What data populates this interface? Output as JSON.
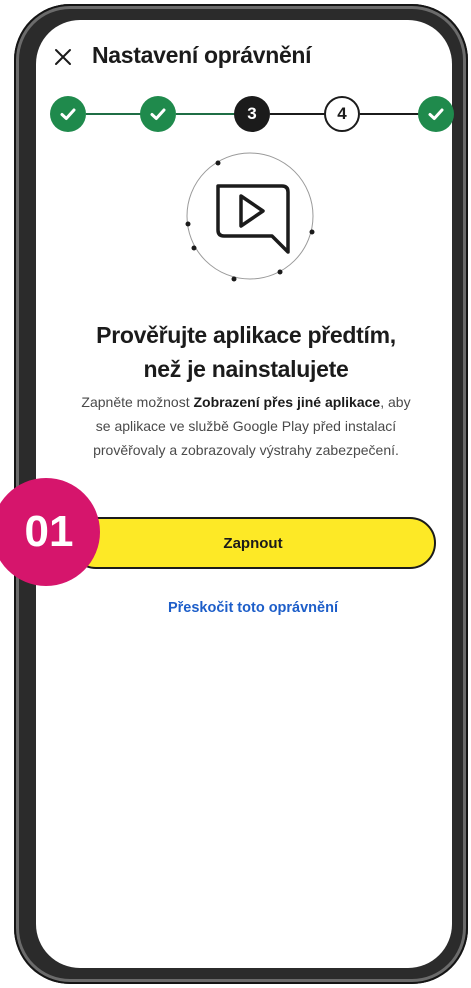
{
  "header": {
    "title": "Nastavení oprávnění",
    "close_icon": "close-icon"
  },
  "stepper": {
    "steps": [
      {
        "status": "done",
        "label": ""
      },
      {
        "status": "done",
        "label": ""
      },
      {
        "status": "current",
        "label": "3"
      },
      {
        "status": "upcoming",
        "label": "4"
      },
      {
        "status": "done",
        "label": ""
      }
    ]
  },
  "illustration": {
    "icon": "play-chat-bubble-icon"
  },
  "content": {
    "headline_line1": "Prověřujte aplikace předtím,",
    "headline_line2": "než je nainstalujete",
    "description_pre": "Zapněte možnost ",
    "description_bold": "Zobrazení přes jiné aplikace",
    "description_post": ", aby se aplikace ve službě Google Play před instalací prověřovaly a zobrazovaly výstrahy zabezpečení."
  },
  "actions": {
    "primary_label": "Zapnout",
    "skip_label": "Přeskočit toto oprávnění"
  },
  "badge": {
    "label": "01"
  },
  "colors": {
    "accent_yellow": "#fde926",
    "step_done_green": "#1f8a4c",
    "badge_pink": "#d6156c",
    "link_blue": "#1d5ec9",
    "frame_dark": "#2b2b2b"
  }
}
